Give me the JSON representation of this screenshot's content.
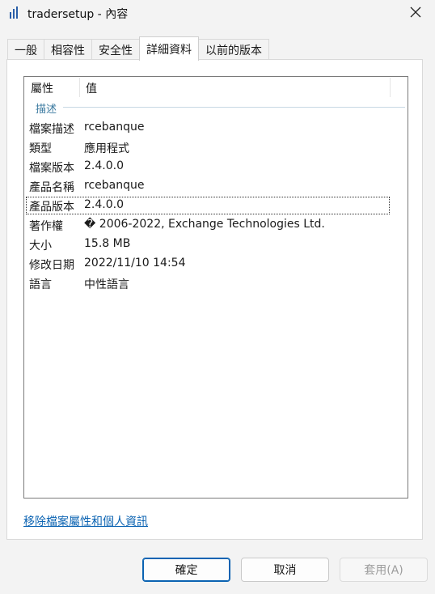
{
  "window": {
    "title": "tradersetup - 內容"
  },
  "tabs": [
    {
      "label": "一般"
    },
    {
      "label": "相容性"
    },
    {
      "label": "安全性"
    },
    {
      "label": "詳細資料"
    },
    {
      "label": "以前的版本"
    }
  ],
  "details": {
    "header": {
      "property": "屬性",
      "value": "值"
    },
    "group_label": "描述",
    "rows": [
      {
        "key": "檔案描述",
        "value": "rcebanque"
      },
      {
        "key": "類型",
        "value": "應用程式"
      },
      {
        "key": "檔案版本",
        "value": "2.4.0.0"
      },
      {
        "key": "產品名稱",
        "value": "rcebanque"
      },
      {
        "key": "產品版本",
        "value": "2.4.0.0"
      },
      {
        "key": "著作權",
        "value": "� 2006-2022, Exchange Technologies Ltd."
      },
      {
        "key": "大小",
        "value": "15.8 MB"
      },
      {
        "key": "修改日期",
        "value": "2022/11/10 14:54"
      },
      {
        "key": "語言",
        "value": "中性語言"
      }
    ]
  },
  "remove_link": "移除檔案屬性和個人資訊",
  "buttons": {
    "ok": "確定",
    "cancel": "取消",
    "apply": "套用(A)"
  }
}
